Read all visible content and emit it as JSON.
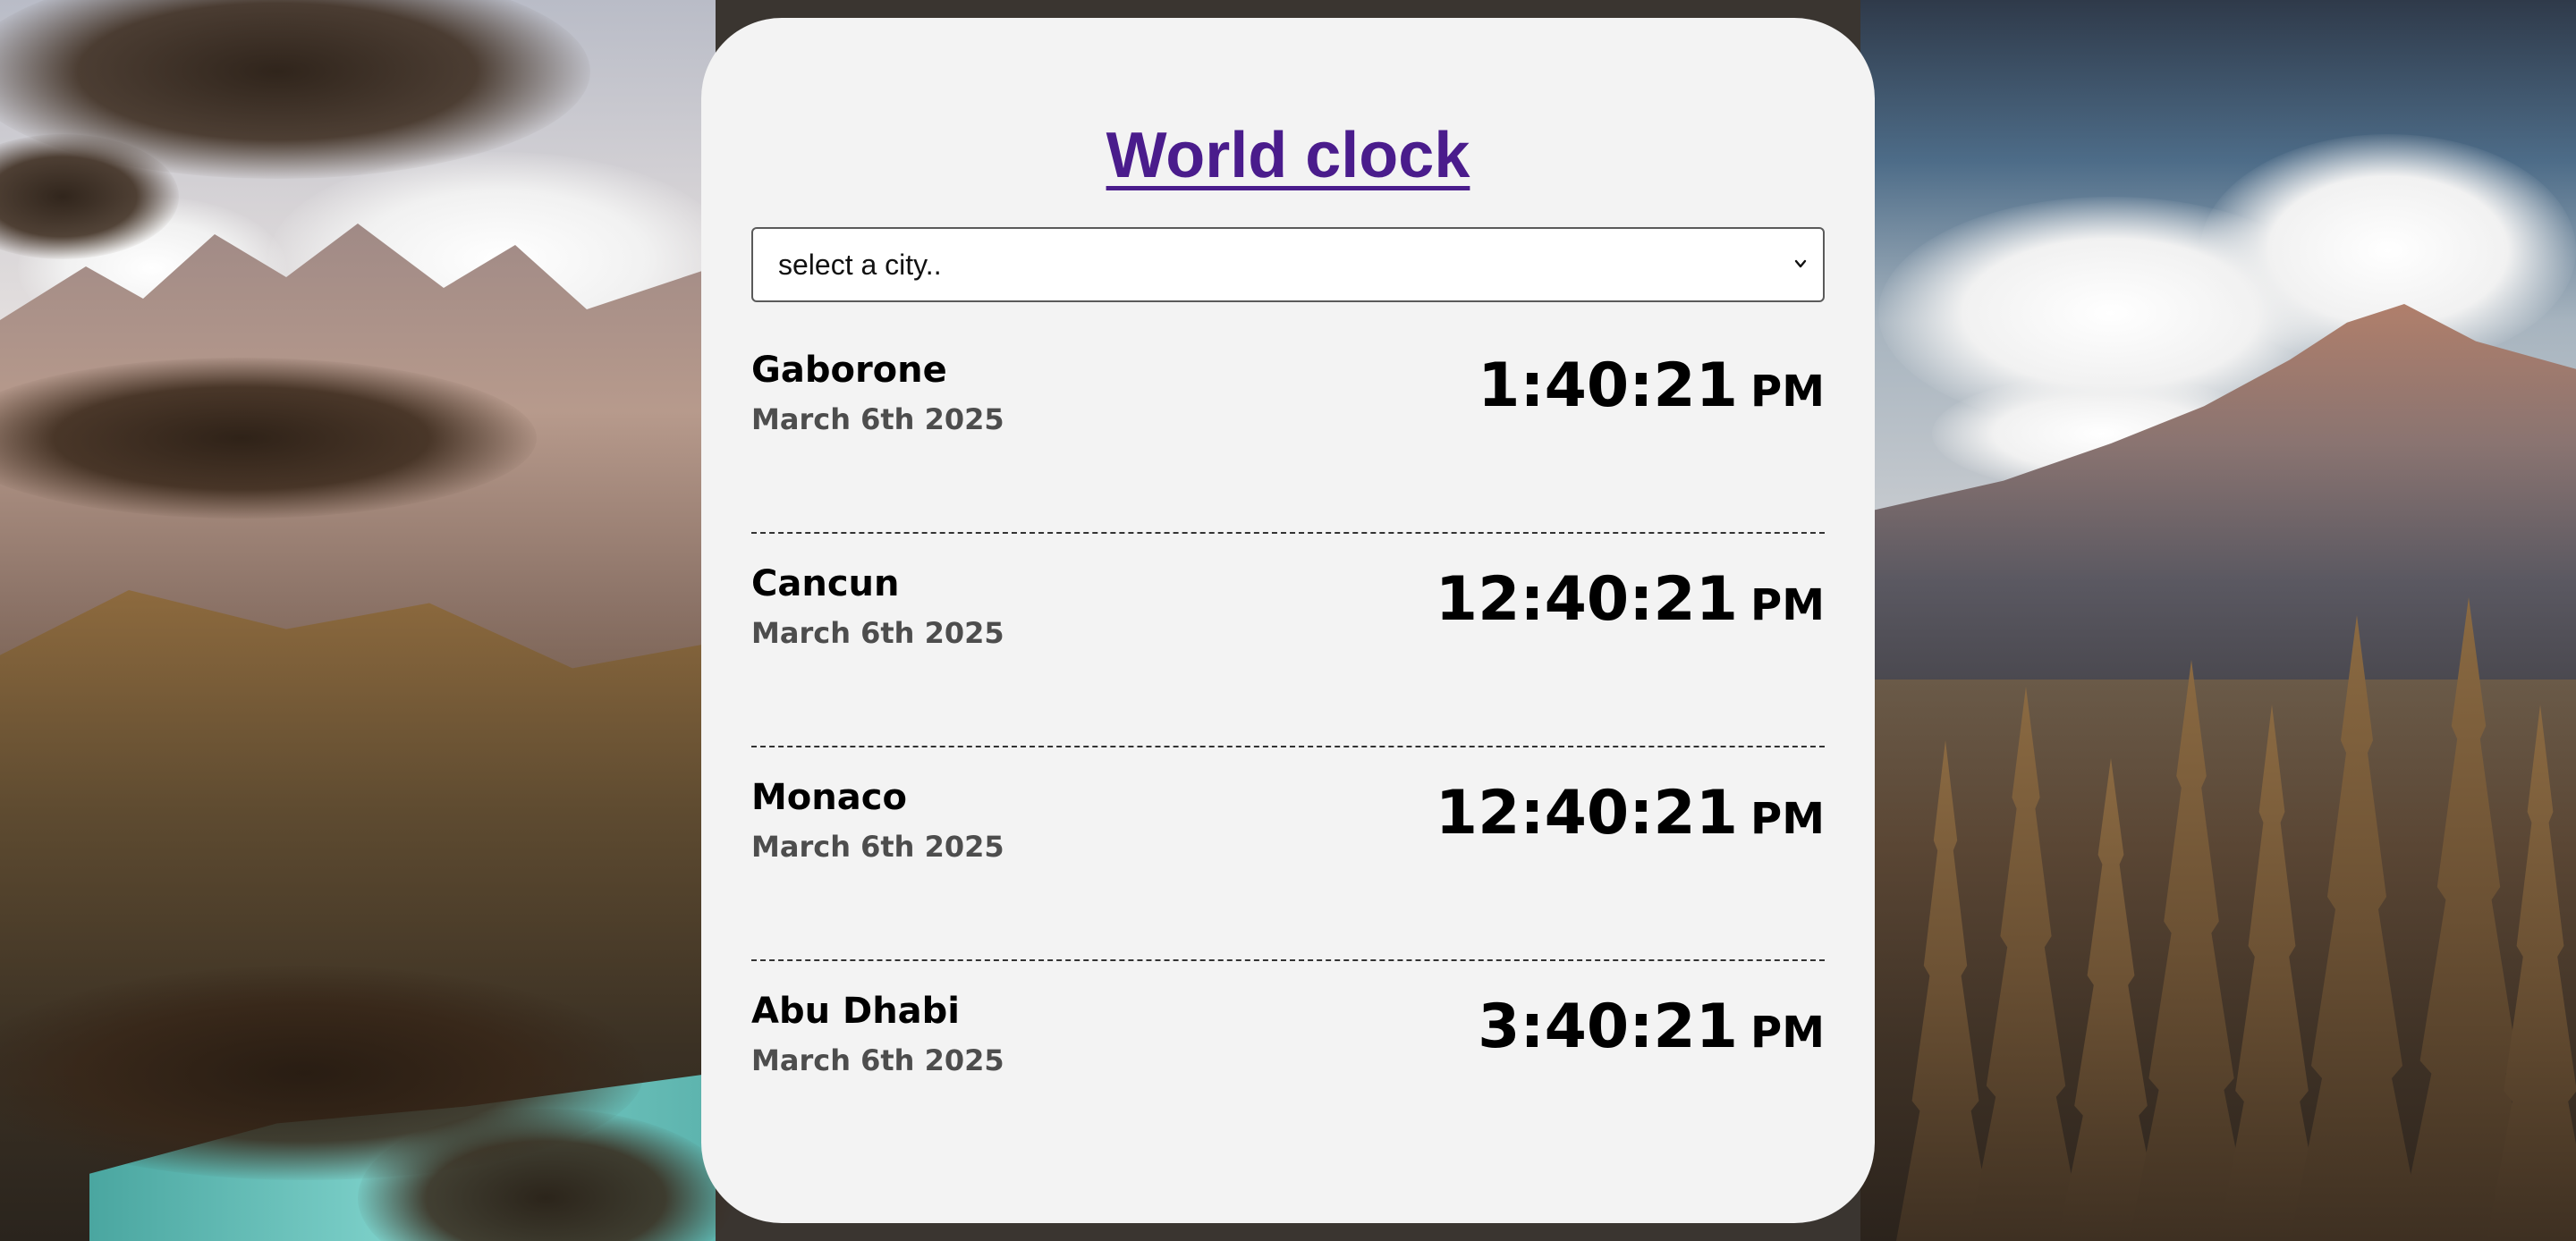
{
  "app": {
    "title": "World clock"
  },
  "city_select": {
    "placeholder": "select a city..",
    "icon": "chevron-down-icon"
  },
  "cities": [
    {
      "name": "Gaborone",
      "date": "March 6th 2025",
      "time": "1:40:21",
      "ampm": "PM"
    },
    {
      "name": "Cancun",
      "date": "March 6th 2025",
      "time": "12:40:21",
      "ampm": "PM"
    },
    {
      "name": "Monaco",
      "date": "March 6th 2025",
      "time": "12:40:21",
      "ampm": "PM"
    },
    {
      "name": "Abu Dhabi",
      "date": "March 6th 2025",
      "time": "3:40:21",
      "ampm": "PM"
    }
  ],
  "colors": {
    "title": "#4a1c8c",
    "card_background": "#f3f3f3",
    "date_text": "#4d4d4d",
    "divider": "#333333"
  }
}
